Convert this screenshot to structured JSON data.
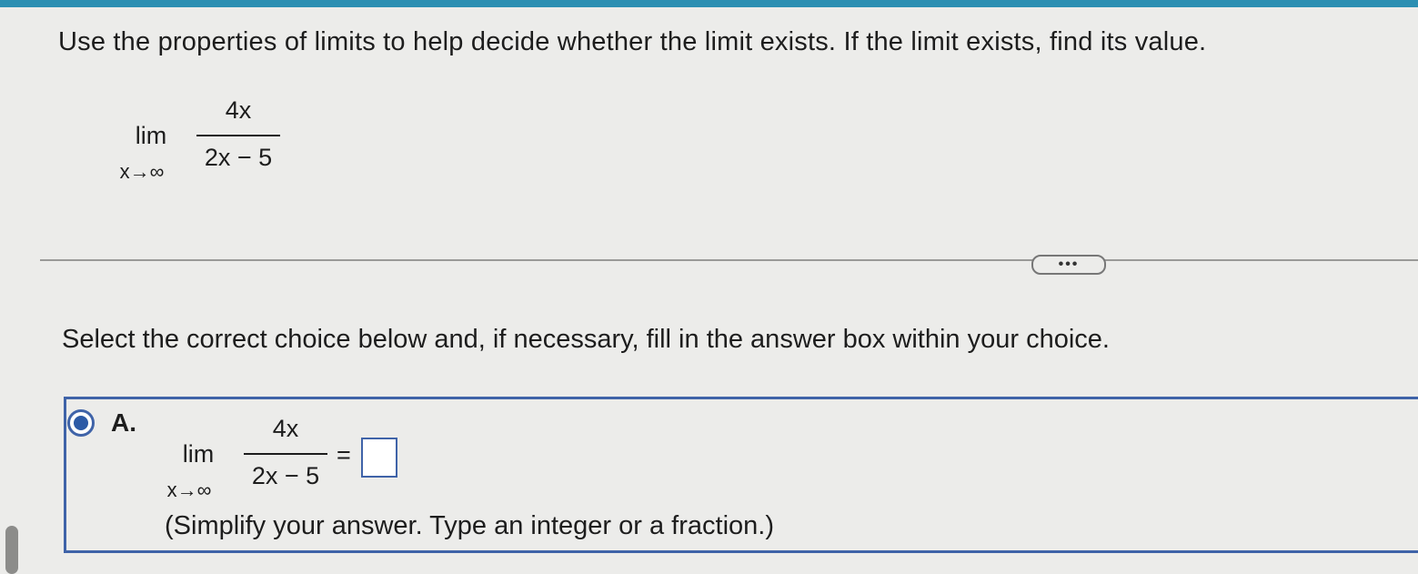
{
  "question": {
    "text": "Use the properties of limits to help decide whether the limit exists. If the limit exists, find its value."
  },
  "expression": {
    "lim": "lim",
    "sub": "x→∞",
    "numerator": "4x",
    "denominator": "2x − 5"
  },
  "more_button": {
    "label": "•••"
  },
  "instruction": "Select the correct choice below and, if necessary, fill in the answer box within your choice.",
  "choice_a": {
    "letter": "A.",
    "selected": true,
    "lim": "lim",
    "sub": "x→∞",
    "numerator": "4x",
    "denominator": "2x − 5",
    "equals": "=",
    "answer_value": "",
    "hint": "(Simplify your answer. Type an integer or a fraction.)"
  },
  "colors": {
    "accent": "#3f63a8",
    "top_strip": "#2c8fb2",
    "background": "#ececea"
  }
}
